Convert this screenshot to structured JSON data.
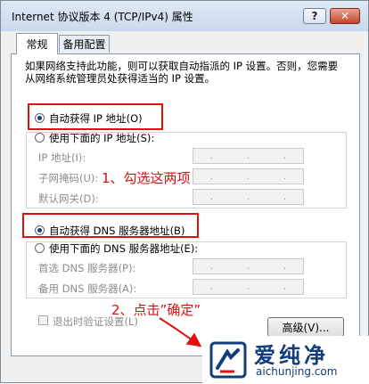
{
  "window": {
    "title": "Internet 协议版本 4 (TCP/IPv4) 属性",
    "help_label": "?",
    "close_label": "✕"
  },
  "tabs": [
    {
      "label": "常规"
    },
    {
      "label": "备用配置"
    }
  ],
  "description": "如果网络支持此功能，则可以获取自动指派的 IP 设置。否则，您需要从网络系统管理员处获得适当的 IP 设置。",
  "ip_section": {
    "auto_label": "自动获得 IP 地址(O)",
    "manual_label": "使用下面的 IP 地址(S):",
    "fields": [
      {
        "label": "IP 地址(I):"
      },
      {
        "label": "子网掩码(U):"
      },
      {
        "label": "默认网关(D):"
      }
    ]
  },
  "dns_section": {
    "auto_label": "自动获得 DNS 服务器地址(B)",
    "manual_label": "使用下面的 DNS 服务器地址(E):",
    "fields": [
      {
        "label": "首选 DNS 服务器(P):"
      },
      {
        "label": "备用 DNS 服务器(A):"
      }
    ]
  },
  "validate_label": "退出时验证设置(L)",
  "advanced_label": "高级(V)...",
  "annotations": {
    "step1": "1、勾选这两项",
    "step2": "2、点击”确定”"
  },
  "watermark": {
    "brand": "爱纯净",
    "domain": "aichunjing.com"
  },
  "colors": {
    "annotation_red": "#e01010",
    "brand_blue": "#123c7a"
  }
}
